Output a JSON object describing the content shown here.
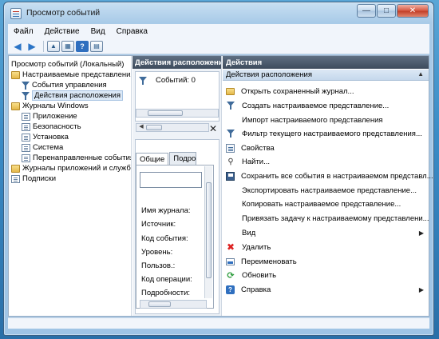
{
  "window": {
    "title": "Просмотр событий",
    "buttons": {
      "minimize": "—",
      "maximize": "□",
      "close": "✕"
    }
  },
  "menu": [
    "Файл",
    "Действие",
    "Вид",
    "Справка"
  ],
  "toolbar": {
    "back_icon": "arrow-left-icon",
    "forward_icon": "arrow-right-icon",
    "up_icon": "folder-up-icon",
    "show_hide_icon": "console-tree-icon",
    "help_glyph": "?",
    "help_icon": "help-icon",
    "view_icon": "view-pane-icon"
  },
  "tree": {
    "root": "Просмотр событий (Локальный)",
    "custom_views": "Настраиваемые представления",
    "admin_events": "События управления",
    "location_actions": "Действия расположения",
    "windows_logs": "Журналы Windows",
    "application": "Приложение",
    "security": "Безопасность",
    "setup": "Установка",
    "system": "Система",
    "forwarded": "Перенаправленные события",
    "app_services_logs": "Журналы приложений и служб",
    "subscriptions": "Подписки"
  },
  "middle": {
    "header": "Действия расположения",
    "row_label": "Событий: 0",
    "close_glyph": "✕",
    "tabs": [
      "Общие",
      "Подробности"
    ],
    "fields": [
      "Имя журнала:",
      "Источник:",
      "Код события:",
      "Уровень:",
      "Пользов.:",
      "Код операции:",
      "Подробности:"
    ]
  },
  "actions": {
    "header": "Действия",
    "section": "Действия расположения",
    "items": [
      {
        "label": "Открыть сохраненный журнал...",
        "icon": "open-log-icon",
        "submenu": false
      },
      {
        "label": "Создать настраиваемое представление...",
        "icon": "create-filter-icon",
        "submenu": false
      },
      {
        "label": "Импорт настраиваемого представления",
        "icon": "",
        "submenu": false
      },
      {
        "label": "Фильтр текущего настраиваемого представления...",
        "icon": "filter-icon",
        "submenu": false
      },
      {
        "label": "Свойства",
        "icon": "properties-icon",
        "submenu": false
      },
      {
        "label": "Найти...",
        "icon": "find-icon",
        "submenu": false
      },
      {
        "label": "Сохранить все события в настраиваемом представл...",
        "icon": "save-icon",
        "submenu": false
      },
      {
        "label": "Экспортировать настраиваемое представление...",
        "icon": "",
        "submenu": false
      },
      {
        "label": "Копировать настраиваемое представление...",
        "icon": "",
        "submenu": false
      },
      {
        "label": "Привязать задачу к настраиваемому представлени...",
        "icon": "",
        "submenu": false
      },
      {
        "label": "Вид",
        "icon": "",
        "submenu": true
      },
      {
        "label": "Удалить",
        "icon": "delete-icon",
        "submenu": false
      },
      {
        "label": "Переименовать",
        "icon": "rename-icon",
        "submenu": false
      },
      {
        "label": "Обновить",
        "icon": "refresh-icon",
        "submenu": false
      },
      {
        "label": "Справка",
        "icon": "help-icon",
        "submenu": true
      }
    ]
  },
  "colors": {
    "pane_header": "#3d4b5c",
    "selection": "#dbe8f6",
    "delete_red": "#dd2222",
    "refresh_green": "#2a9b3a"
  }
}
